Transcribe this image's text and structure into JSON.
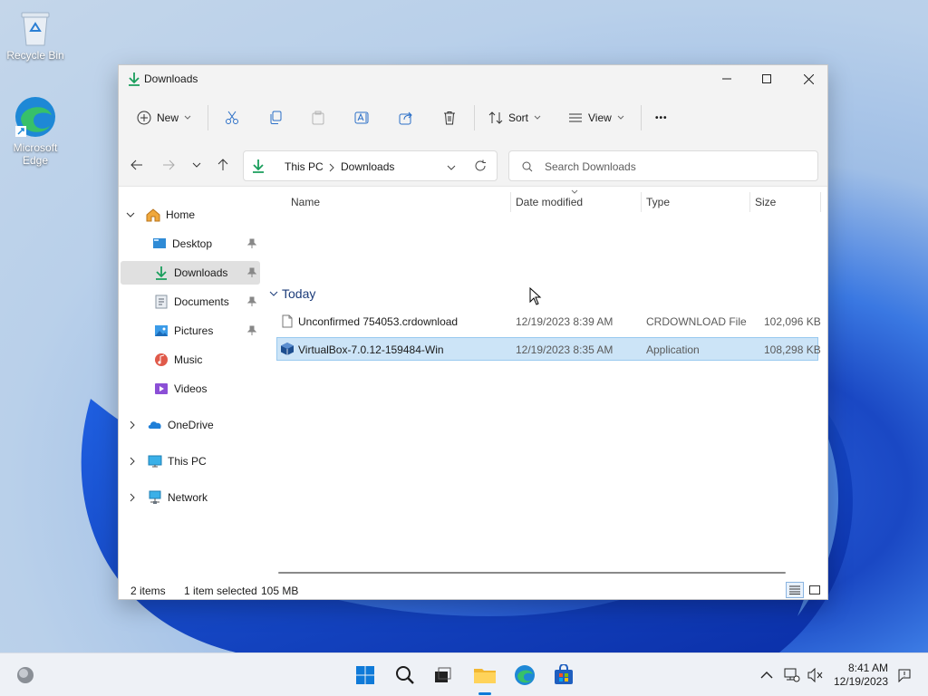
{
  "desktop": {
    "icons": [
      {
        "label": "Recycle Bin",
        "icon": "recycle-bin-icon"
      },
      {
        "label": "Microsoft Edge",
        "icon": "edge-icon"
      }
    ]
  },
  "window": {
    "title": "Downloads",
    "controls": [
      "minimize-icon",
      "maximize-icon",
      "close-icon"
    ]
  },
  "toolbar": {
    "new_label": "New",
    "sort_label": "Sort",
    "view_label": "View",
    "more_label": "•••",
    "icons": [
      "cut-icon",
      "copy-icon",
      "paste-icon",
      "rename-icon",
      "share-icon",
      "delete-icon"
    ]
  },
  "address": {
    "crumbs": [
      "This PC",
      "Downloads"
    ],
    "search_placeholder": "Search Downloads"
  },
  "sidebar": {
    "items": [
      {
        "label": "Home",
        "icon": "home-icon"
      },
      {
        "label": "Desktop",
        "icon": "desktop-icon"
      },
      {
        "label": "Downloads",
        "icon": "download-icon"
      },
      {
        "label": "Documents",
        "icon": "documents-icon"
      },
      {
        "label": "Pictures",
        "icon": "pictures-icon"
      },
      {
        "label": "Music",
        "icon": "music-icon"
      },
      {
        "label": "Videos",
        "icon": "videos-icon"
      },
      {
        "label": "OneDrive",
        "icon": "onedrive-icon"
      },
      {
        "label": "This PC",
        "icon": "this-pc-icon"
      },
      {
        "label": "Network",
        "icon": "network-icon"
      }
    ]
  },
  "list": {
    "columns": [
      "Name",
      "Date modified",
      "Type",
      "Size"
    ],
    "group": "Today",
    "rows": [
      {
        "name": "Unconfirmed 754053.crdownload",
        "date": "12/19/2023 8:39 AM",
        "type": "CRDOWNLOAD File",
        "size": "102,096 KB",
        "icon": "file-icon"
      },
      {
        "name": "VirtualBox-7.0.12-159484-Win",
        "date": "12/19/2023 8:35 AM",
        "type": "Application",
        "size": "108,298 KB",
        "icon": "virtualbox-icon"
      }
    ]
  },
  "status": {
    "items": "2 items",
    "selected": "1 item selected",
    "size": "105 MB"
  },
  "taskbar": {
    "time": "8:41 AM",
    "date": "12/19/2023"
  },
  "colors": {
    "accent": "#0078d4",
    "selection": "#cce4f7",
    "download_green": "#1a9e5c"
  }
}
